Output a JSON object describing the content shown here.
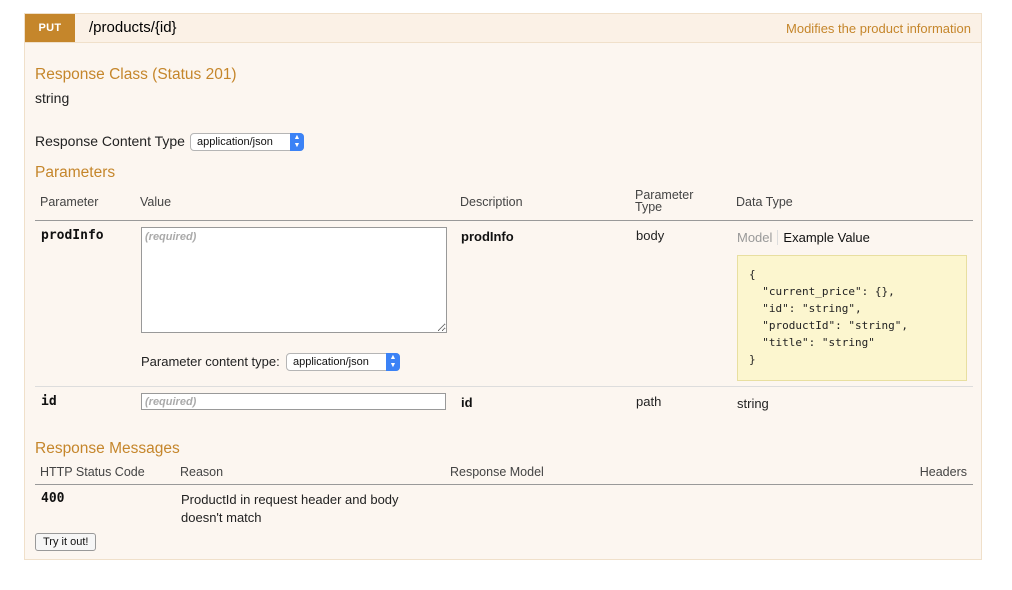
{
  "operation": {
    "method": "PUT",
    "path": "/products/{id}",
    "summary": "Modifies the product information"
  },
  "response_class": {
    "heading": "Response Class (Status 201)",
    "type": "string"
  },
  "response_content_type": {
    "label": "Response Content Type",
    "selected": "application/json"
  },
  "parameters": {
    "heading": "Parameters",
    "columns": [
      "Parameter",
      "Value",
      "Description",
      "Parameter Type",
      "Data Type"
    ],
    "column_type_line1": "Parameter",
    "column_type_line2": "Type",
    "rows": [
      {
        "name": "prodInfo",
        "placeholder": "(required)",
        "description": "prodInfo",
        "param_type": "body",
        "content_type_label": "Parameter content type:",
        "content_type_selected": "application/json",
        "tab_model": "Model",
        "tab_example": "Example Value",
        "example_lines": [
          "{",
          "  \"current_price\": {},",
          "  \"id\": \"string\",",
          "  \"productId\": \"string\",",
          "  \"title\": \"string\"",
          "}"
        ]
      },
      {
        "name": "id",
        "placeholder": "(required)",
        "description": "id",
        "param_type": "path",
        "data_type": "string"
      }
    ]
  },
  "response_messages": {
    "heading": "Response Messages",
    "columns": [
      "HTTP Status Code",
      "Reason",
      "Response Model",
      "Headers"
    ],
    "rows": [
      {
        "code": "400",
        "reason_line1": "ProductId in request header and body",
        "reason_line2": "doesn't match"
      }
    ]
  },
  "try_button": "Try it out!",
  "colors": {
    "accent": "#c5862b",
    "panel_bg": "#fcf6f0",
    "example_bg": "#fcf6cf",
    "select_arrow": "#3b82f6"
  }
}
